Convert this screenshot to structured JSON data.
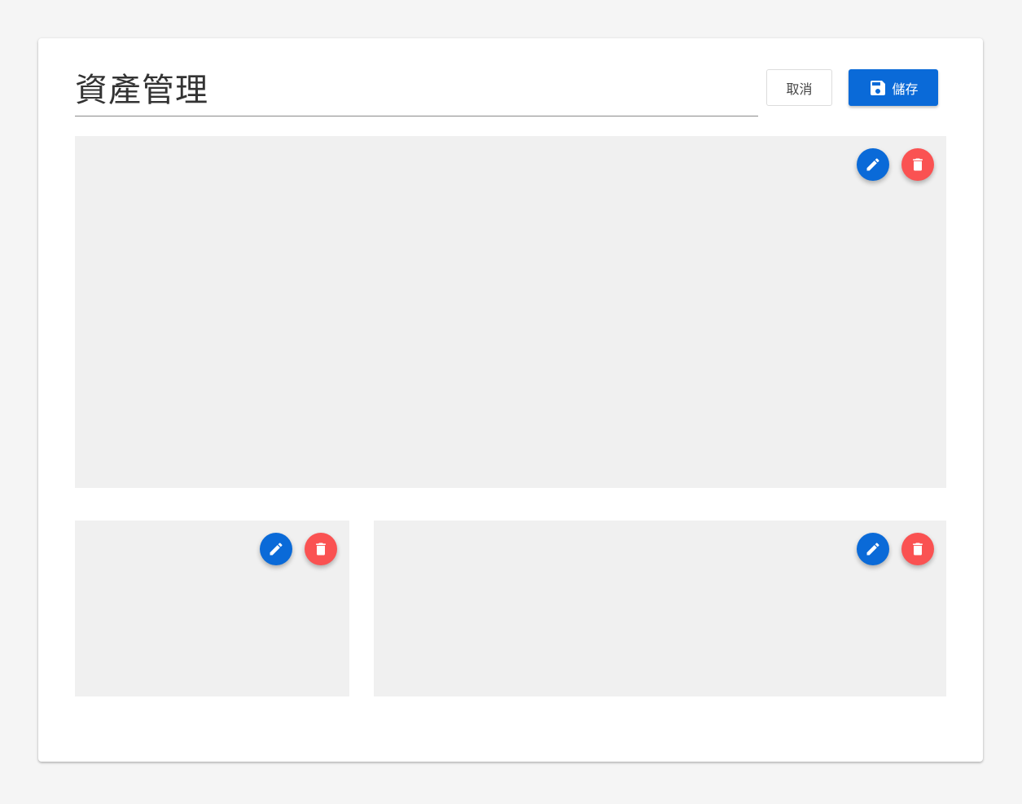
{
  "header": {
    "title_value": "資產管理",
    "cancel_label": "取消",
    "save_label": "儲存"
  },
  "panels": [
    {
      "id": "panel-1",
      "actions": [
        "edit",
        "delete"
      ]
    },
    {
      "id": "panel-2",
      "actions": [
        "edit",
        "delete"
      ]
    },
    {
      "id": "panel-3",
      "actions": [
        "edit",
        "delete"
      ]
    }
  ],
  "icons": {
    "save": "floppy-disk-icon",
    "edit": "pencil-icon",
    "delete": "trash-icon"
  },
  "colors": {
    "primary": "#0a6ad8",
    "danger": "#fa5252",
    "panel_bg": "#f0f0f0",
    "page_bg": "#f5f5f5"
  }
}
